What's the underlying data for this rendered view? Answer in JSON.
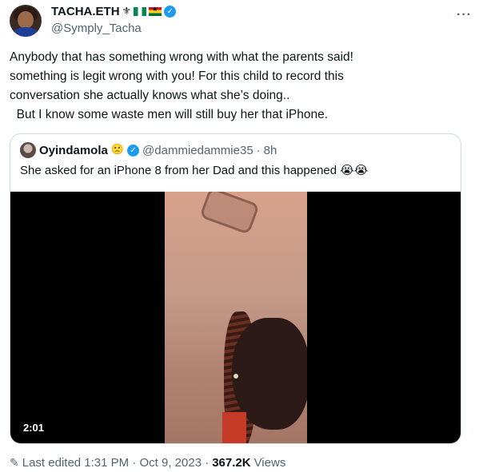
{
  "author": {
    "name": "TACHA.ETH",
    "name_emoji": "⚜",
    "handle": "@Symply_Tacha",
    "verified_icon": "verified-badge-icon"
  },
  "more_label": "···",
  "tweet": {
    "lines": [
      "Anybody that has something wrong with what the parents said!",
      "something is legit wrong with you! For this child to record this",
      "conversation she actually knows what she’s doing..",
      "  But I know some waste men will still buy her that iPhone."
    ]
  },
  "quote": {
    "name": "Oyindamola",
    "name_emoji": "🙁",
    "handle": "@dammiedammie35",
    "separator": "·",
    "time": "8h",
    "text": "She asked for an iPhone 8 from her Dad and this happened 😭😭",
    "video_duration": "2:01"
  },
  "footer": {
    "edited": "Last edited 1:31 PM · Oct 9, 2023 ·",
    "views_count": "367.2K",
    "views_label": "Views"
  },
  "colors": {
    "text": "#0f1419",
    "secondary": "#536471",
    "verified": "#1d9bf0",
    "border": "#cfd9de"
  }
}
